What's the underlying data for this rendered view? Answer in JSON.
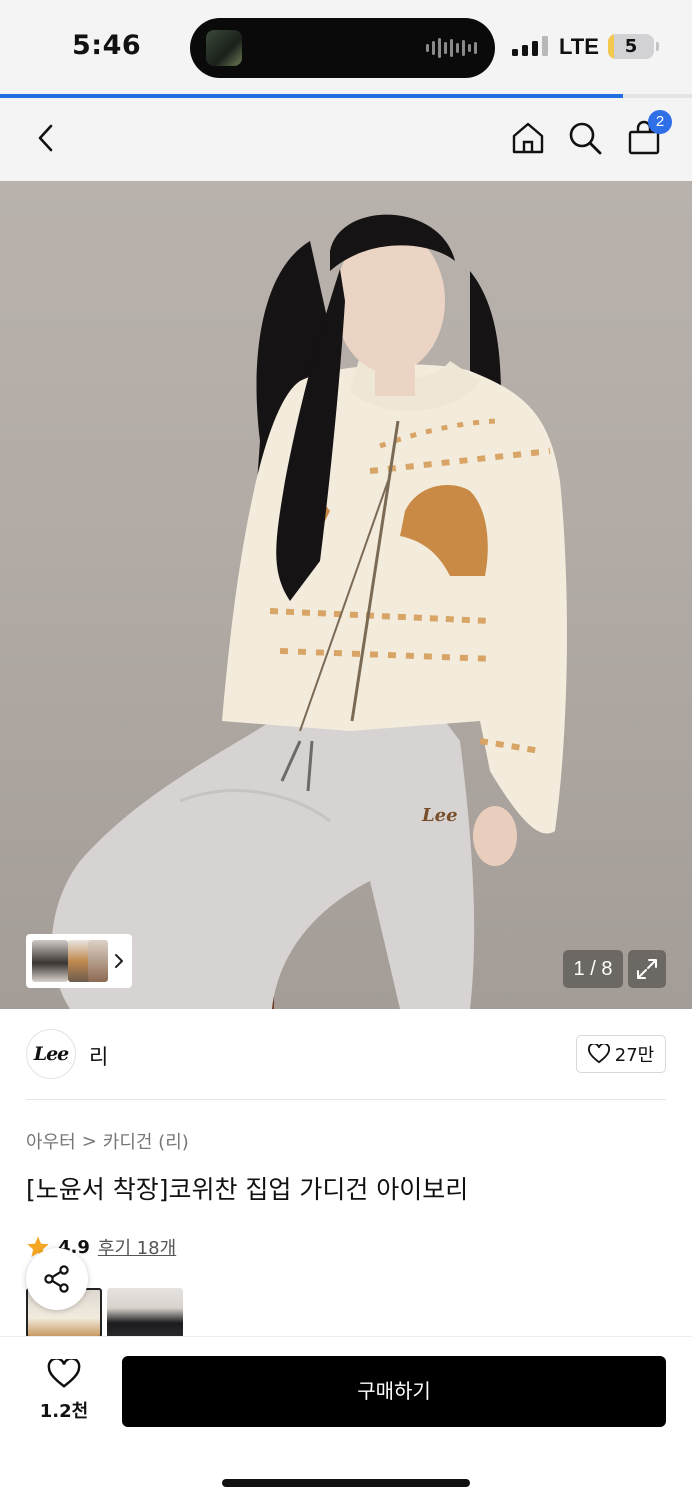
{
  "status_bar": {
    "time": "5:46",
    "network": "LTE",
    "battery_level": "5",
    "battery_fraction": 0.12
  },
  "page_load_progress": 0.9,
  "header": {
    "back_icon": "chevron-left-icon",
    "home_icon": "home-icon",
    "search_icon": "search-icon",
    "cart_icon": "shopping-bag-icon",
    "cart_badge": "2",
    "accent_color": "#2f6fe8"
  },
  "gallery": {
    "counter": "1 / 8",
    "expand_icon": "expand-icon",
    "thumb_more_icon": "chevron-right-icon"
  },
  "brand": {
    "logo_text": "Lee",
    "name": "리",
    "like_count": "27만"
  },
  "breadcrumb": {
    "category": "아우터",
    "separator": ">",
    "subcategory": "카디건 (리)"
  },
  "product": {
    "title": "[노윤서 착장]코위찬 집업 가디건 아이보리",
    "rating": "4.9",
    "review_link": "후기 18개",
    "star_color": "#f5a623"
  },
  "bottom_bar": {
    "wish_count": "1.2천",
    "buy_label": "구매하기"
  }
}
